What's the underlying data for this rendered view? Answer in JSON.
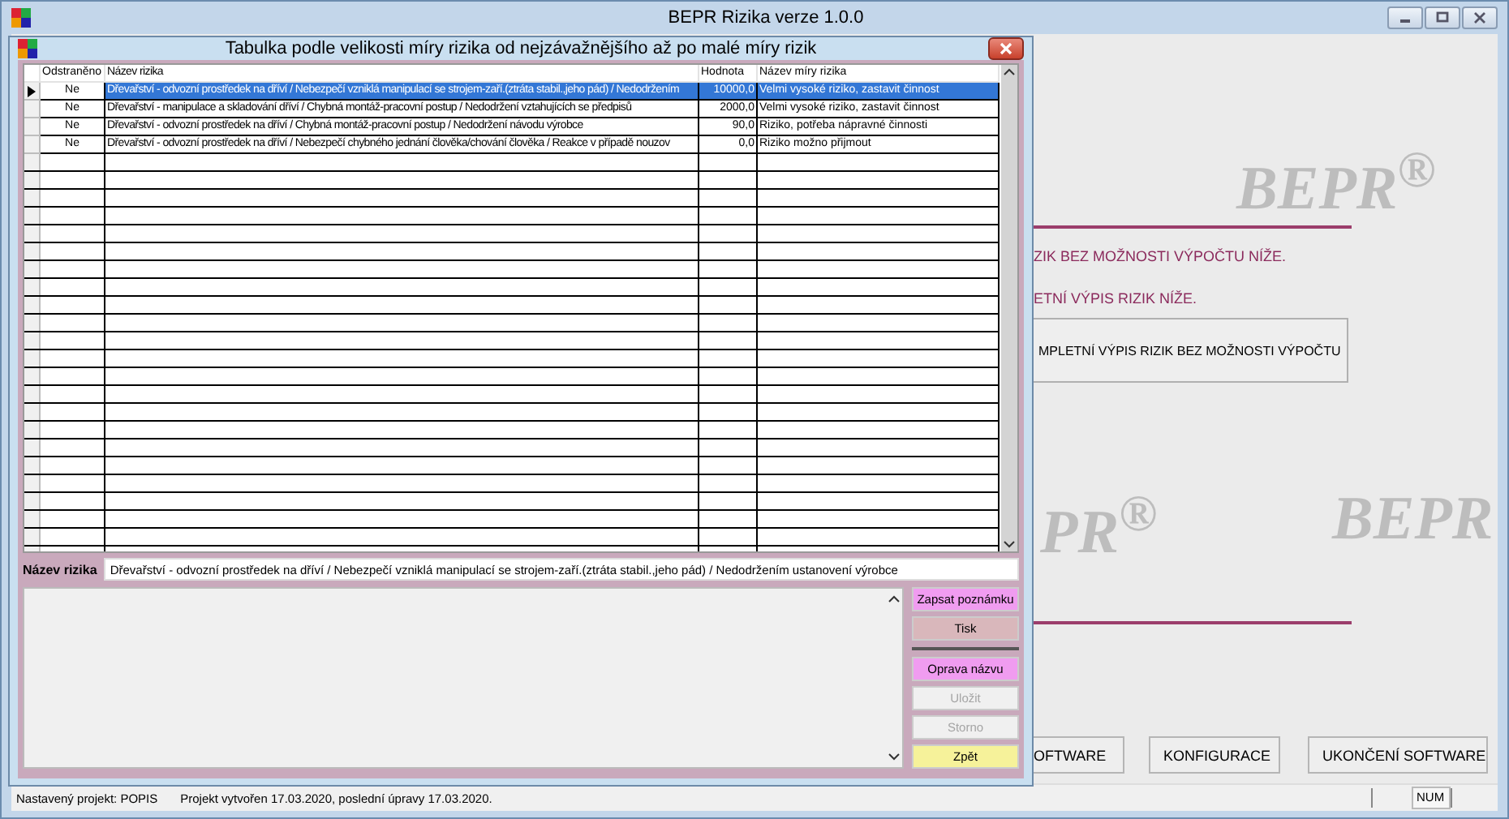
{
  "window": {
    "title": "BEPR Rizika verze 1.0.0"
  },
  "background": {
    "watermarks": [
      "BEPR$^{®}$",
      "PR$^{®}$",
      "BEPR"
    ],
    "lines": [
      "ZIK BEZ MOŽNOSTI VÝPOČTU NÍŽE.",
      "ETNÍ VÝPIS RIZIK NÍŽE."
    ],
    "main_button": "MPLETNÍ VÝPIS RIZIK BEZ MOŽNOSTI VÝPOČTU",
    "bottom_buttons": [
      "OFTWARE",
      "KONFIGURACE",
      "UKONČENÍ SOFTWARE"
    ]
  },
  "dialog": {
    "title": "Tabulka podle velikosti míry rizika od nejzávažnějšího až po malé míry rizik",
    "table": {
      "columns": [
        "Odstraněno",
        "Název rizika",
        "Hodnota",
        "Název míry rizika"
      ],
      "rows": [
        {
          "selected": true,
          "cells": [
            "Ne",
            "Dřevařství - odvozní prostředek na dříví / Nebezpečí vzniklá manipulací se strojem-zaří.(ztráta stabil.,jeho pád) / Nedodržením",
            "10000,0",
            "Velmi vysoké riziko, zastavit činnost"
          ]
        },
        {
          "selected": false,
          "cells": [
            "Ne",
            "Dřevařství - manipulace a skladování dříví / Chybná montáž-pracovní postup / Nedodržení vztahujících se předpisů",
            "2000,0",
            "Velmi vysoké riziko, zastavit činnost"
          ]
        },
        {
          "selected": false,
          "cells": [
            "Ne",
            "Dřevařství - odvozní prostředek na dříví / Chybná montáž-pracovní postup / Nedodržení návodu výrobce",
            "90,0",
            "Riziko, potřeba nápravné činnosti"
          ]
        },
        {
          "selected": false,
          "cells": [
            "Ne",
            "Dřevařství - odvozní prostředek na dříví / Nebezpečí chybného jednání člověka/chování člověka / Reakce v případě nouzov",
            "0,0",
            "Riziko možno přijmout"
          ]
        }
      ]
    },
    "name_label": "Název rizika",
    "name_value": "Dřevařství - odvozní prostředek na dříví / Nebezpečí vzniklá manipulací se strojem-zaří.(ztráta stabil.,jeho pád) / Nedodržením ustanovení výrobce",
    "buttons": [
      {
        "label": "Zapsat poznámku",
        "kind": "pink",
        "disabled": false
      },
      {
        "label": "Tisk",
        "kind": "rose",
        "disabled": false
      },
      {
        "label": "Oprava názvu",
        "kind": "pink",
        "disabled": false
      },
      {
        "label": "Uložit",
        "kind": "plain",
        "disabled": true
      },
      {
        "label": "Storno",
        "kind": "plain",
        "disabled": true
      },
      {
        "label": "Zpět",
        "kind": "yellow",
        "disabled": false
      }
    ]
  },
  "status_bar": {
    "project": "Nastavený projekt: POPIS",
    "dates": "Projekt vytvořen 17.03.2020, poslední úpravy 17.03.2020.",
    "num": "NUM"
  }
}
